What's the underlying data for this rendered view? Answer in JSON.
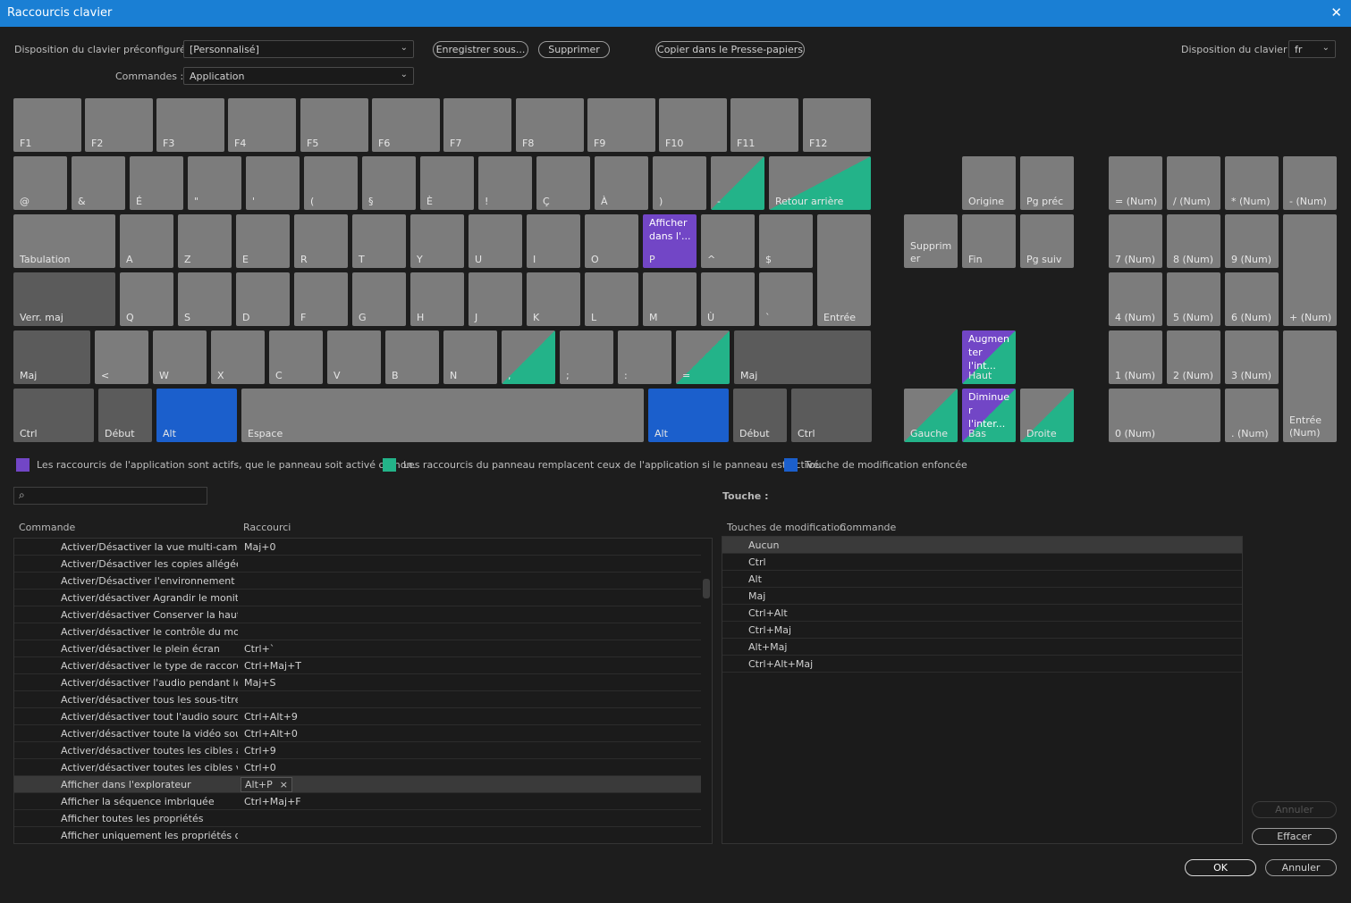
{
  "window": {
    "title": "Raccourcis clavier",
    "close": "✕"
  },
  "toolbar": {
    "preset_label": "Disposition du clavier préconfigurée :",
    "preset_value": "[Personnalisé]",
    "save_as": "Enregistrer sous...",
    "delete": "Supprimer",
    "copy_clipboard": "Copier dans le Presse-papiers",
    "layout_label": "Disposition du clavier :",
    "layout_value": "fr",
    "commands_label": "Commandes :",
    "commands_value": "Application"
  },
  "keys": {
    "f1": "F1",
    "f2": "F2",
    "f3": "F3",
    "f4": "F4",
    "f5": "F5",
    "f6": "F6",
    "f7": "F7",
    "f8": "F8",
    "f9": "F9",
    "f10": "F10",
    "f11": "F11",
    "f12": "F12",
    "at": "@",
    "amp": "&",
    "e_acute": "É",
    "quote": "\"",
    "apos": "'",
    "paren_open": "(",
    "section": "§",
    "e_grave": "È",
    "excl": "!",
    "c_cedil": "Ç",
    "a_grave": "À",
    "paren_close": ")",
    "minus": "-",
    "backspace": "Retour arrière",
    "tab": "Tabulation",
    "a": "A",
    "z": "Z",
    "e": "E",
    "r": "R",
    "t": "T",
    "y": "Y",
    "u": "U",
    "i": "I",
    "o": "O",
    "p": "P",
    "p_action": "Afficher dans l'...",
    "caret": "^",
    "dollar": "$",
    "enter": "Entrée",
    "caps": "Verr. maj",
    "q": "Q",
    "s": "S",
    "d": "D",
    "f": "F",
    "g": "G",
    "h": "H",
    "j": "J",
    "k": "K",
    "l": "L",
    "m": "M",
    "u_grave": "Ù",
    "backtick": "`",
    "shift_left": "Maj",
    "lt": "<",
    "w": "W",
    "x": "X",
    "c": "C",
    "v": "V",
    "b": "B",
    "n": "N",
    "comma": ",",
    "semicolon": ";",
    "colon": ":",
    "equal": "=",
    "shift_right": "Maj",
    "ctrl_left": "Ctrl",
    "home_left": "Début",
    "alt_left": "Alt",
    "space": "Espace",
    "alt_right": "Alt",
    "home_right": "Début",
    "ctrl_right": "Ctrl",
    "home": "Origine",
    "pgup": "Pg préc",
    "delete": "Supprim er",
    "end": "Fin",
    "pgdn": "Pg suiv",
    "up": "Haut",
    "up_action": "Augmen ter l'int...",
    "left": "Gauche",
    "down": "Bas",
    "down_action": "Diminue r l'inter...",
    "right": "Droite",
    "num_eq": "= (Num)",
    "num_div": "/ (Num)",
    "num_mul": "* (Num)",
    "num_sub": "- (Num)",
    "num7": "7 (Num)",
    "num8": "8 (Num)",
    "num9": "9 (Num)",
    "num_add": "+ (Num)",
    "num4": "4 (Num)",
    "num5": "5 (Num)",
    "num6": "6 (Num)",
    "num1": "1 (Num)",
    "num2": "2 (Num)",
    "num3": "3 (Num)",
    "num_enter": "Entrée (Num)",
    "num0": "0 (Num)",
    "num_dot": ". (Num)"
  },
  "legend": {
    "app": "Les raccourcis de l'application sont actifs, que le panneau soit activé ou non.",
    "panel": "Les raccourcis du panneau remplacent ceux de l'application si le panneau est activé.",
    "modifier": "Touche de modification enfoncée",
    "colors": {
      "app": "#7246c6",
      "panel": "#23b389",
      "modifier": "#1b5fcc"
    }
  },
  "search": {
    "icon": "search-icon",
    "glyph": "⌕",
    "value": ""
  },
  "commands_table": {
    "col_command": "Commande",
    "col_shortcut": "Raccourci",
    "rows": [
      {
        "command": "Activer/Désactiver la vue multi-caméras",
        "shortcut": "Maj+0"
      },
      {
        "command": "Activer/Désactiver les copies allégées",
        "shortcut": ""
      },
      {
        "command": "Activer/Désactiver l'environnement immersif",
        "shortcut": ""
      },
      {
        "command": "Activer/désactiver Agrandir le moniteur",
        "shortcut": ""
      },
      {
        "command": "Activer/désactiver Conserver la hauteur",
        "shortcut": ""
      },
      {
        "command": "Activer/désactiver le contrôle du mode c",
        "shortcut": ""
      },
      {
        "command": "Activer/désactiver le plein écran",
        "shortcut": "Ctrl+`"
      },
      {
        "command": "Activer/désactiver le type de raccord",
        "shortcut": "Ctrl+Maj+T"
      },
      {
        "command": "Activer/désactiver l'audio pendant le défilement",
        "shortcut": "Maj+S"
      },
      {
        "command": "Activer/désactiver tous les sous-titres sc",
        "shortcut": ""
      },
      {
        "command": "Activer/désactiver tout l'audio source",
        "shortcut": "Ctrl+Alt+9"
      },
      {
        "command": "Activer/désactiver toute la vidéo source",
        "shortcut": "Ctrl+Alt+0"
      },
      {
        "command": "Activer/désactiver toutes les cibles audio",
        "shortcut": "Ctrl+9"
      },
      {
        "command": "Activer/désactiver toutes les cibles vidéo",
        "shortcut": "Ctrl+0"
      },
      {
        "command": "Afficher dans l'explorateur",
        "shortcut": "Alt+P"
      },
      {
        "command": "Afficher la séquence imbriquée",
        "shortcut": "Ctrl+Maj+F"
      },
      {
        "command": "Afficher toutes les propriétés",
        "shortcut": ""
      },
      {
        "command": "Afficher uniquement les propriétés d'image",
        "shortcut": ""
      }
    ],
    "chip_close": "×"
  },
  "key_panel": {
    "title": "Touche :",
    "col_modifiers": "Touches de modification",
    "col_command": "Commande",
    "rows": [
      "Aucun",
      "Ctrl",
      "Alt",
      "Maj",
      "Ctrl+Alt",
      "Ctrl+Maj",
      "Alt+Maj",
      "Ctrl+Alt+Maj"
    ]
  },
  "buttons": {
    "undo": "Annuler",
    "clear": "Effacer",
    "ok": "OK",
    "cancel": "Annuler"
  }
}
